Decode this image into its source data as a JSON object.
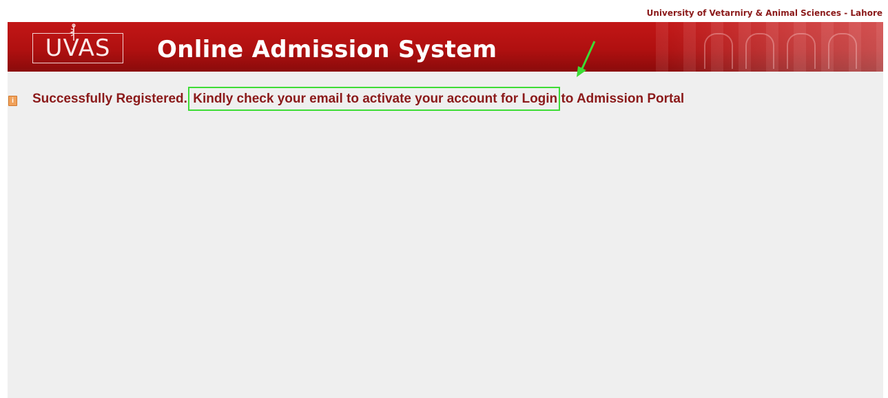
{
  "header": {
    "university_link": "University of Vetarniry & Animal Sciences - Lahore",
    "logo_text": "UVAS",
    "title": "Online Admission System"
  },
  "alert": {
    "icon": "info-icon",
    "prefix": "Successfully Registered.",
    "highlighted": "Kindly check your email to activate your account for Login",
    "suffix": "to Admission Portal"
  },
  "colors": {
    "banner": "#b01010",
    "text": "#8b1a1a",
    "highlight_outline": "#3ddc35",
    "content_bg": "#efefef"
  }
}
